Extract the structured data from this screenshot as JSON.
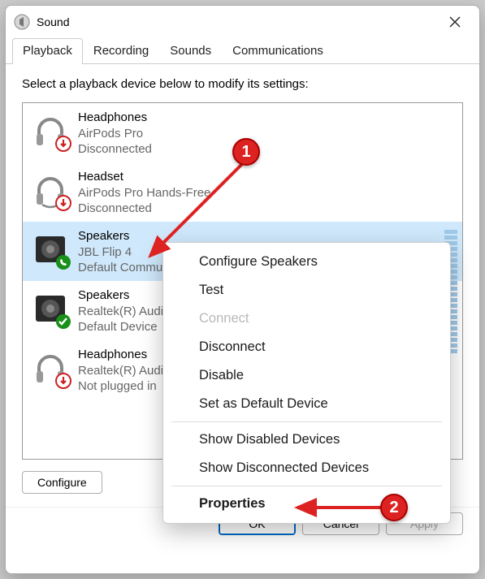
{
  "window": {
    "title": "Sound"
  },
  "tabs": [
    "Playback",
    "Recording",
    "Sounds",
    "Communications"
  ],
  "active_tab": 0,
  "instruction": "Select a playback device below to modify its settings:",
  "devices": [
    {
      "name": "Headphones",
      "sub": "AirPods Pro",
      "status": "Disconnected",
      "icon": "headphones",
      "badge": "down-red"
    },
    {
      "name": "Headset",
      "sub": "AirPods Pro Hands-Free",
      "status": "Disconnected",
      "icon": "headset",
      "badge": "down-red"
    },
    {
      "name": "Speakers",
      "sub": "JBL Flip 4",
      "status": "Default Communications Device",
      "icon": "speaker",
      "badge": "phone-green",
      "selected": true
    },
    {
      "name": "Speakers",
      "sub": "Realtek(R) Audio",
      "status": "Default Device",
      "icon": "speaker",
      "badge": "check-green"
    },
    {
      "name": "Headphones",
      "sub": "Realtek(R) Audio",
      "status": "Not plugged in",
      "icon": "headphones",
      "badge": "down-red"
    }
  ],
  "context_menu": {
    "items": [
      {
        "label": "Configure Speakers",
        "enabled": true
      },
      {
        "label": "Test",
        "enabled": true
      },
      {
        "label": "Connect",
        "enabled": false
      },
      {
        "label": "Disconnect",
        "enabled": true
      },
      {
        "label": "Disable",
        "enabled": true
      },
      {
        "label": "Set as Default Device",
        "enabled": true
      }
    ],
    "toggles": [
      {
        "label": "Show Disabled Devices",
        "checked": true
      },
      {
        "label": "Show Disconnected Devices",
        "checked": true
      }
    ],
    "final": {
      "label": "Properties",
      "bold": true
    }
  },
  "buttons": {
    "configure": "Configure",
    "properties": "Properties",
    "ok": "OK",
    "cancel": "Cancel",
    "apply": "Apply"
  },
  "annotations": {
    "marker1": "1",
    "marker2": "2"
  }
}
